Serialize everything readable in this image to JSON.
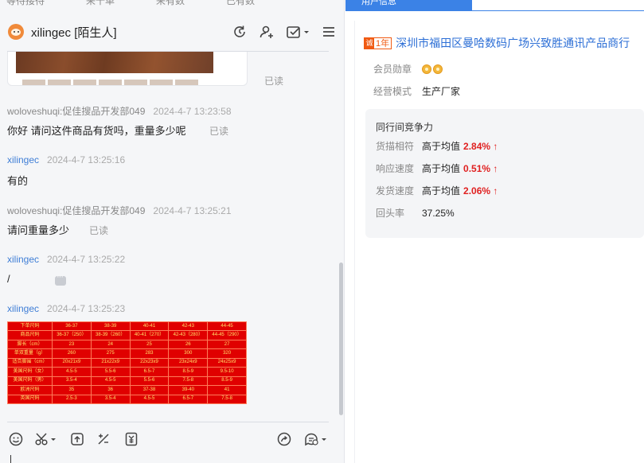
{
  "top_tabs": [
    "等待接待",
    "来千单",
    "来有数",
    "已有数"
  ],
  "header": {
    "name": "xilingec [陌生人]",
    "icons": [
      "refresh-icon",
      "add-user-icon",
      "check-task-icon",
      "menu-icon"
    ]
  },
  "previous_message": {
    "status": "已读"
  },
  "messages": [
    {
      "sender": "woloveshuqi:促佳搜品开发部049",
      "time": "2024-4-7 13:23:58",
      "text": "你好 请问这件商品有货吗，重量多少呢",
      "status": "已读",
      "self": false
    },
    {
      "sender": "xilingec",
      "time": "2024-4-7 13:25:16",
      "text": "有的",
      "self": true
    },
    {
      "sender": "woloveshuqi:促佳搜品开发部049",
      "time": "2024-4-7 13:25:21",
      "text": "请问重量多少",
      "status": "已读",
      "self": false
    },
    {
      "sender": "xilingec",
      "time": "2024-4-7 13:25:22",
      "text": "/",
      "self": true
    },
    {
      "sender": "xilingec",
      "time": "2024-4-7 13:25:23",
      "text": "",
      "self": true
    }
  ],
  "size_table": [
    [
      "下单尺码",
      "36-37",
      "38-39",
      "40-41",
      "42-43",
      "44-45"
    ],
    [
      "商品尺码",
      "36-37（250）",
      "38-39（260）",
      "40-41（270）",
      "42-43（280）",
      "44-45（290）"
    ],
    [
      "脚长（cm）",
      "23",
      "24",
      "25",
      "26",
      "27"
    ],
    [
      "单双重量（g）",
      "260",
      "275",
      "283",
      "300",
      "320"
    ],
    [
      "适合脚围（cm）",
      "20x21x9",
      "21x22x9",
      "22x23x9",
      "23x24x9",
      "24x25x9"
    ],
    [
      "美国尺码（女）",
      "4.5-5",
      "5.5-6",
      "6.5-7",
      "8.5-9",
      "9.5-10"
    ],
    [
      "美国尺码（男）",
      "3.5-4",
      "4.5-5",
      "5.5-6",
      "7.5-8",
      "8.5-9"
    ],
    [
      "欧洲尺码",
      "35",
      "36",
      "37-38",
      "39-40",
      "41"
    ],
    [
      "英国尺码",
      "2.5-3",
      "3.5-4",
      "4.5-5",
      "6.5-7",
      "7.5-8"
    ]
  ],
  "toolbar": [
    "emoji-icon",
    "scissors-icon",
    "upload-icon",
    "discount-icon",
    "price-tag-icon",
    "share-icon",
    "quick-reply-icon"
  ],
  "right": {
    "tab": "用户信息",
    "company_badge": "1年",
    "company_name": "深圳市福田区曼哈数码广场兴致胜通讯产品商行",
    "member_medal_label": "会员勋章",
    "business_mode_label": "经营模式",
    "business_mode_value": "生产厂家",
    "competitiveness": {
      "title": "同行间竞争力",
      "rows": [
        {
          "label": "货描相符",
          "text": "高于均值",
          "value": "2.84% ↑"
        },
        {
          "label": "响应速度",
          "text": "高于均值",
          "value": "0.51% ↑"
        },
        {
          "label": "发货速度",
          "text": "高于均值",
          "value": "2.06% ↑"
        },
        {
          "label": "回头率",
          "text": "37.25%",
          "value": ""
        }
      ]
    }
  },
  "colors": {
    "accent": "#3b82e6",
    "link": "#2d6fd6",
    "highlight": "#e02020",
    "badge": "#f05a12"
  }
}
